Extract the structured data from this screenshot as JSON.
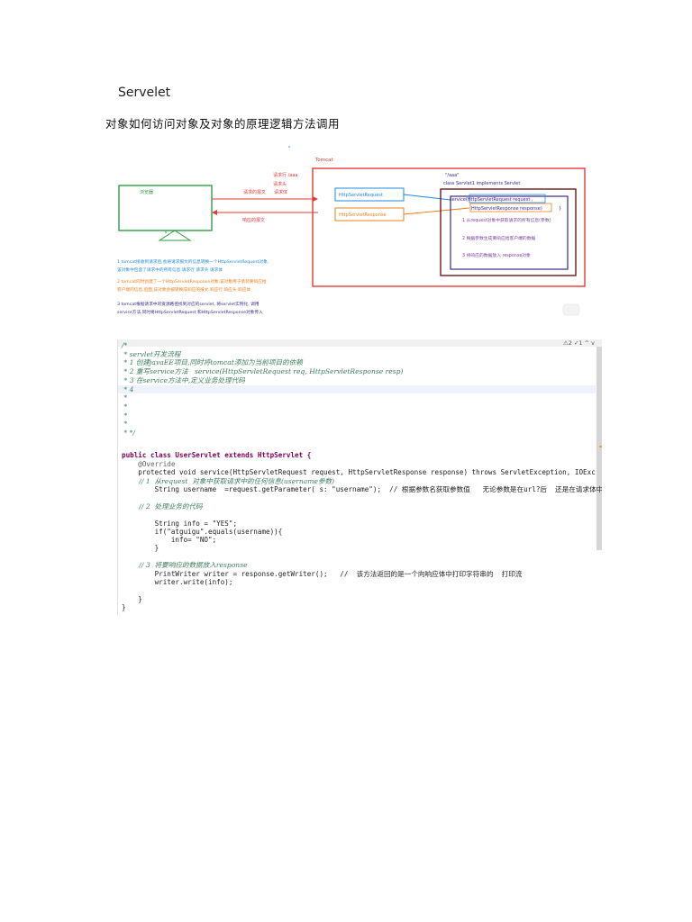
{
  "page": {
    "title": "Servelet",
    "subtitle": "对象如何访问对象及对象的原理逻辑方法调用"
  },
  "diagram": {
    "browser_label": "浏览器",
    "tomcat_label": "Tomcat",
    "request_line": "请求行 /aaa",
    "request_head": "请求头",
    "request_msg": "请求的报文",
    "request_body": "请求体",
    "response_msg": "响应的报文",
    "url": "\"/aaa\"",
    "class_decl": "class Servlet1    implements Servlet",
    "service_call": "service(HttpServletRequest request ,",
    "response_param": "HttpServletResponse response)",
    "brace": "}",
    "req_box": "HttpServletRequest",
    "resp_box": "HttpServletResponse",
    "step1": "1 从request对象中获取请求的所有信息(参数)",
    "step2": "2 根据参数生成要响应给客户端的数据",
    "step3": "3 将响应的数据放入 response对象",
    "note1a": "1 tomcat接收到请求后,会将请求报文的信息转换一个HttpServletRequest对象,",
    "note1b": "该对象中包含了请求中的所有信息    请求行  请求头  请求体",
    "note2a": "2 tomcat同时创建了一个HttpServletResponse对象,该对象用于承装要响应给",
    "note2b": "客户端的信息,后面,该对象会被转换成响应的报文  响应行  响应头  响应体",
    "note3a": "3 tomcat根据请求中的资源路径找到对应的servlet, 将servlet实例化, 调用",
    "note3b": "service方法,同时将HttpServletRequest 和HttpServletResponse对象传入",
    "colors": {
      "red": "#e53935",
      "green": "#2e9e44",
      "blue": "#1e88e5",
      "orange": "#ef7f1a",
      "navy": "#3b2a8c",
      "maroon": "#6d1a1a"
    }
  },
  "code": {
    "status": "⚠2 ✓1 ^ v",
    "lines": [
      "/*",
      " * servlet开发流程",
      " * 1 创建javaEE项目,同时将tomcat添加为当前项目的依赖",
      " * 2 重写service方法   service(HttpServletRequest req, HttpServletResponse resp)",
      " * 3 在service方法中,定义业务处理代码",
      " * 4",
      " *",
      " *",
      " *",
      " *",
      " * */",
      "",
      "public class UserServlet extends HttpServlet {",
      "    @Override",
      "    protected void service(HttpServletRequest request, HttpServletResponse response) throws ServletException, IOExc",
      "        // 1  从request  对象中获取请求中的任何信息(username参数)",
      "        String username  =request.getParameter( s: \"username\");  // 根据参数名获取参数值   无论参数是在url?后  还是在请求体中",
      "",
      "        // 2  处理业务的代码",
      "",
      "        String info = \"YES\";",
      "        if(\"atguigu\".equals(username)){",
      "            info= \"NO\";",
      "        }",
      "",
      "        // 3  将要响应的数据放入response",
      "        PrintWriter writer = response.getWriter();   //  该方法返回的是一个向响应体中打印字符串的  打印流",
      "        writer.write(info);",
      "",
      "    }",
      "}"
    ]
  }
}
